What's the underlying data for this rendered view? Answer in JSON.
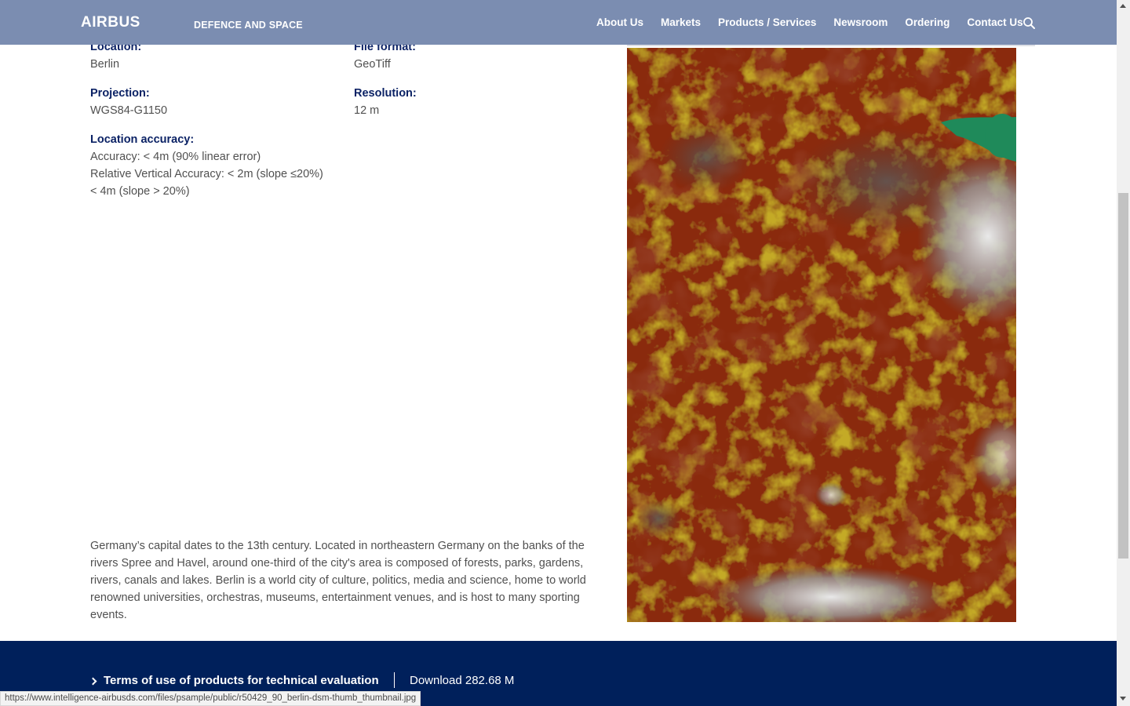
{
  "header": {
    "logo": "AIRBUS",
    "subbrand": "DEFENCE AND SPACE",
    "nav": [
      "About Us",
      "Markets",
      "Products / Services",
      "Newsroom",
      "Ordering",
      "Contact Us"
    ],
    "search_icon": "search-icon"
  },
  "specs": {
    "location": {
      "label": "Location:",
      "value": "Berlin"
    },
    "file_format": {
      "label": "File format:",
      "value": "GeoTiff"
    },
    "projection": {
      "label": "Projection:",
      "value": "WGS84-G1150"
    },
    "resolution": {
      "label": "Resolution:",
      "value": "12 m"
    },
    "location_accuracy": {
      "label": "Location accuracy:",
      "lines": [
        "Accuracy: < 4m (90% linear error)",
        "Relative Vertical Accuracy: < 2m (slope ≤20%)",
        "< 4m (slope > 20%)"
      ]
    }
  },
  "description": "Germany’s capital dates to the 13th century. Located in northeastern Germany on the banks of the rivers Spree and Havel, around one-third of the city's area is composed of forests, parks, gardens, rivers, canals and lakes. Berlin is a world city of culture, politics, media and science, home to world renowned universities, orchestras, museums, entertainment venues, and is host to many sporting events.",
  "footer": {
    "terms_label": "Terms of use of products for technical evaluation",
    "download_label": "Download 282.68 M"
  },
  "status_url": "https://www.intelligence-airbusds.com/files/psample/public/r50429_90_berlin-dsm-thumb_thumbnail.jpg",
  "colors": {
    "navy": "#00205b",
    "header": "#7b8db1",
    "label": "#0b2265"
  }
}
